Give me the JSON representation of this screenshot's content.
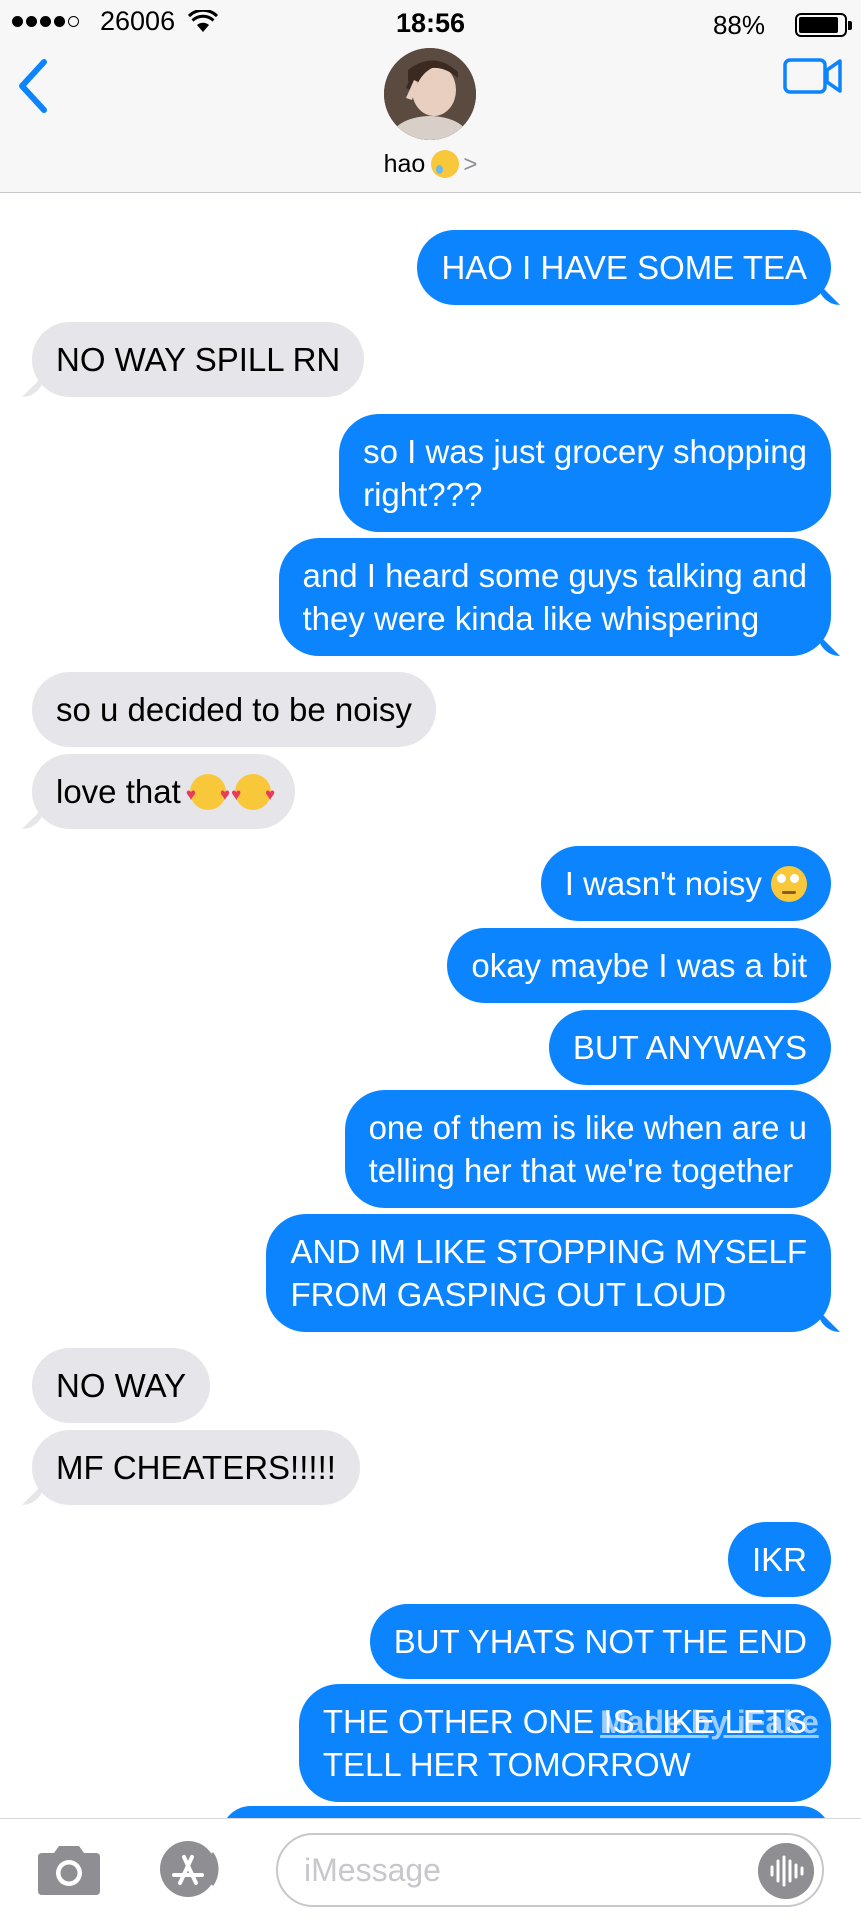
{
  "status_bar": {
    "carrier": "26006",
    "time": "18:56",
    "battery": "88%",
    "battery_level": 0.88
  },
  "header": {
    "contact_name": "hao",
    "back_icon": "chevron-left-icon",
    "video_icon": "video-camera-icon",
    "accent": "#0b84fe"
  },
  "messages": [
    {
      "side": "sent",
      "text": "HAO I HAVE SOME TEA"
    },
    {
      "side": "received",
      "text": "NO WAY SPILL RN"
    },
    {
      "side": "sent",
      "lines": [
        "so I was just grocery shopping",
        "right???"
      ]
    },
    {
      "side": "sent",
      "lines": [
        "and I heard some guys talking and",
        "they were kinda like whispering"
      ]
    },
    {
      "side": "received",
      "text": "so u decided to be noisy"
    },
    {
      "side": "received",
      "text": "love that",
      "emoji": "smiling-face-with-hearts x2"
    },
    {
      "side": "sent",
      "text": "I wasn't noisy",
      "emoji": "face-with-rolling-eyes"
    },
    {
      "side": "sent",
      "text": "okay maybe I was a bit"
    },
    {
      "side": "sent",
      "text": "BUT ANYWAYS"
    },
    {
      "side": "sent",
      "lines": [
        "one of them is like when are u",
        "telling her that we're together"
      ]
    },
    {
      "side": "sent",
      "lines": [
        "AND IM LIKE STOPPING MYSELF",
        "FROM GASPING OUT LOUD"
      ]
    },
    {
      "side": "received",
      "text": "NO WAY"
    },
    {
      "side": "received",
      "text": "MF CHEATERS!!!!!"
    },
    {
      "side": "sent",
      "text": "IKR"
    },
    {
      "side": "sent",
      "text": "BUT YHATS NOT THE END"
    },
    {
      "side": "sent",
      "lines": [
        "THE OTHER ONE IS LIKE LETS",
        "TELL HER TOMORROW"
      ]
    }
  ],
  "watermark": "Made by iFake",
  "input_bar": {
    "placeholder": "iMessage",
    "camera_icon": "camera-icon",
    "apps_icon": "app-store-icon",
    "audio_icon": "audio-waveform-icon"
  },
  "colors": {
    "sent_bubble": "#0b84fe",
    "received_bubble": "#e5e5ea"
  }
}
